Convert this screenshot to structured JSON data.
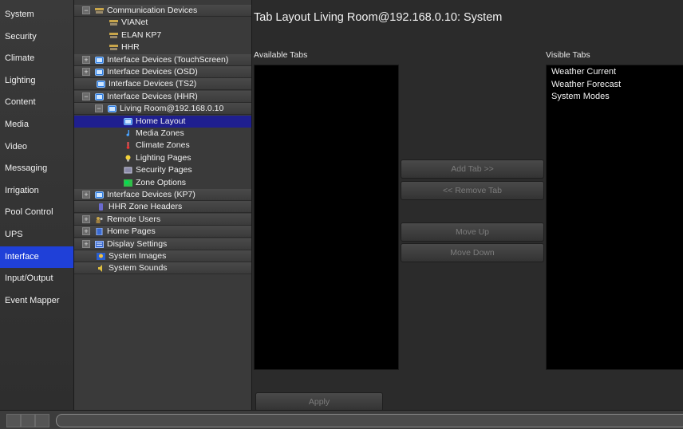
{
  "sidebar": {
    "items": [
      {
        "label": "System"
      },
      {
        "label": "Security"
      },
      {
        "label": "Climate"
      },
      {
        "label": "Lighting"
      },
      {
        "label": "Content"
      },
      {
        "label": "Media"
      },
      {
        "label": "Video"
      },
      {
        "label": "Messaging"
      },
      {
        "label": "Irrigation"
      },
      {
        "label": "Pool Control"
      },
      {
        "label": "UPS"
      },
      {
        "label": "Interface",
        "active": true
      },
      {
        "label": "Input/Output"
      },
      {
        "label": "Event Mapper"
      }
    ]
  },
  "tree": {
    "nodes": [
      {
        "label": "Communication Devices",
        "icon": "network-icon",
        "level": 0,
        "expander": "minus"
      },
      {
        "label": "VIANet",
        "icon": "network-icon",
        "level": 1
      },
      {
        "label": "ELAN KP7",
        "icon": "network-icon",
        "level": 1
      },
      {
        "label": "HHR",
        "icon": "network-icon",
        "level": 1
      },
      {
        "label": "Interface Devices (TouchScreen)",
        "icon": "monitor-icon",
        "level": 0,
        "expander": "plus"
      },
      {
        "label": "Interface Devices (OSD)",
        "icon": "monitor-icon",
        "level": 0,
        "expander": "plus"
      },
      {
        "label": "Interface Devices (TS2)",
        "icon": "monitor-icon",
        "level": 0
      },
      {
        "label": "Interface Devices (HHR)",
        "icon": "monitor-icon",
        "level": 0,
        "expander": "minus"
      },
      {
        "label": "Living Room@192.168.0.10",
        "icon": "monitor-icon",
        "level": 1,
        "expander": "minus"
      },
      {
        "label": "Home Layout",
        "icon": "monitor-icon",
        "level": 2,
        "selected": true
      },
      {
        "label": "Media Zones",
        "icon": "music-note-icon",
        "level": 2
      },
      {
        "label": "Climate Zones",
        "icon": "thermometer-icon",
        "level": 2
      },
      {
        "label": "Lighting Pages",
        "icon": "lightbulb-icon",
        "level": 2
      },
      {
        "label": "Security Pages",
        "icon": "security-icon",
        "level": 2
      },
      {
        "label": "Zone Options",
        "icon": "zone-icon",
        "level": 2
      },
      {
        "label": "Interface Devices (KP7)",
        "icon": "monitor-icon",
        "level": 0,
        "expander": "plus"
      },
      {
        "label": "HHR Zone Headers",
        "icon": "handheld-icon",
        "level": 0
      },
      {
        "label": "Remote Users",
        "icon": "users-icon",
        "level": 0,
        "expander": "plus"
      },
      {
        "label": "Home Pages",
        "icon": "page-icon",
        "level": 0,
        "expander": "plus"
      },
      {
        "label": "Display Settings",
        "icon": "display-icon",
        "level": 0,
        "expander": "plus"
      },
      {
        "label": "System Images",
        "icon": "image-icon",
        "level": 0
      },
      {
        "label": "System Sounds",
        "icon": "speaker-icon",
        "level": 0
      }
    ]
  },
  "main": {
    "title": "Tab Layout Living Room@192.168.0.10: System",
    "available_label": "Available Tabs",
    "visible_label": "Visible Tabs",
    "available_tabs": [],
    "visible_tabs": [
      "Weather Current",
      "Weather Forecast",
      "System Modes"
    ],
    "buttons": {
      "add": "Add Tab >>",
      "remove": "<< Remove Tab",
      "move_up": "Move Up",
      "move_down": "Move Down",
      "apply": "Apply"
    }
  },
  "colors": {
    "selection": "#1f40d8",
    "tree_selection": "#1f1f8f",
    "background": "#2b2b2b"
  }
}
